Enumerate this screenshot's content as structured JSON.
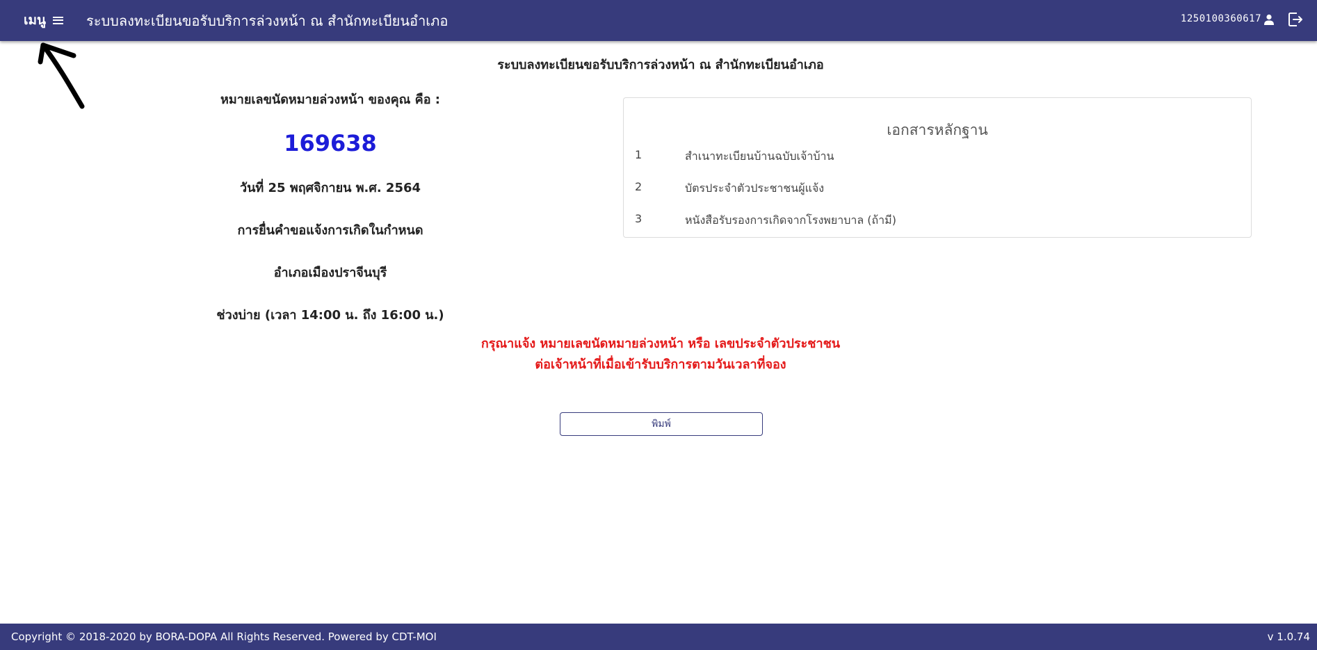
{
  "header": {
    "menu_label": "เมนู",
    "title": "ระบบลงทะเบียนขอรับบริการล่วงหน้า ณ สำนักทะเบียนอำเภอ",
    "user_id": "1250100360617"
  },
  "main": {
    "heading": "ระบบลงทะเบียนขอรับบริการล่วงหน้า ณ สำนักทะเบียนอำเภอ",
    "queue_label": "หมายเลขนัดหมายล่วงหน้า ของคุณ คือ :",
    "queue_number": "169638",
    "date": "วันที่ 25 พฤศจิกายน พ.ศ. 2564",
    "service": "การยื่นคำขอแจ้งการเกิดในกำหนด",
    "office": "อำเภอเมืองปราจีนบุรี",
    "time_slot": "ช่วงบ่าย (เวลา 14:00 น. ถึง 16:00 น.)",
    "warning_line1": "กรุณาแจ้ง หมายเลขนัดหมายล่วงหน้า หรือ เลขประจำตัวประชาชน",
    "warning_line2": "ต่อเจ้าหน้าที่เมื่อเข้ารับบริการตามวันเวลาที่จอง",
    "print_label": "พิมพ์"
  },
  "documents": {
    "title": "เอกสารหลักฐาน",
    "items": [
      {
        "num": "1",
        "text": "สำเนาทะเบียนบ้านฉบับเจ้าบ้าน"
      },
      {
        "num": "2",
        "text": "บัตรประจำตัวประชาชนผู้แจ้ง"
      },
      {
        "num": "3",
        "text": "หนังสือรับรองการเกิดจากโรงพยาบาล (ถ้ามี)"
      }
    ]
  },
  "footer": {
    "copyright": "Copyright © 2018-2020 by BORA-DOPA All Rights Reserved. Powered by CDT-MOI",
    "version": "v 1.0.74"
  },
  "colors": {
    "brand": "#373b7c",
    "queue_number": "#1c1cd8",
    "warning": "#e41a1a"
  },
  "icons": [
    "hamburger-icon",
    "user-icon",
    "logout-icon",
    "annotation-arrow"
  ]
}
